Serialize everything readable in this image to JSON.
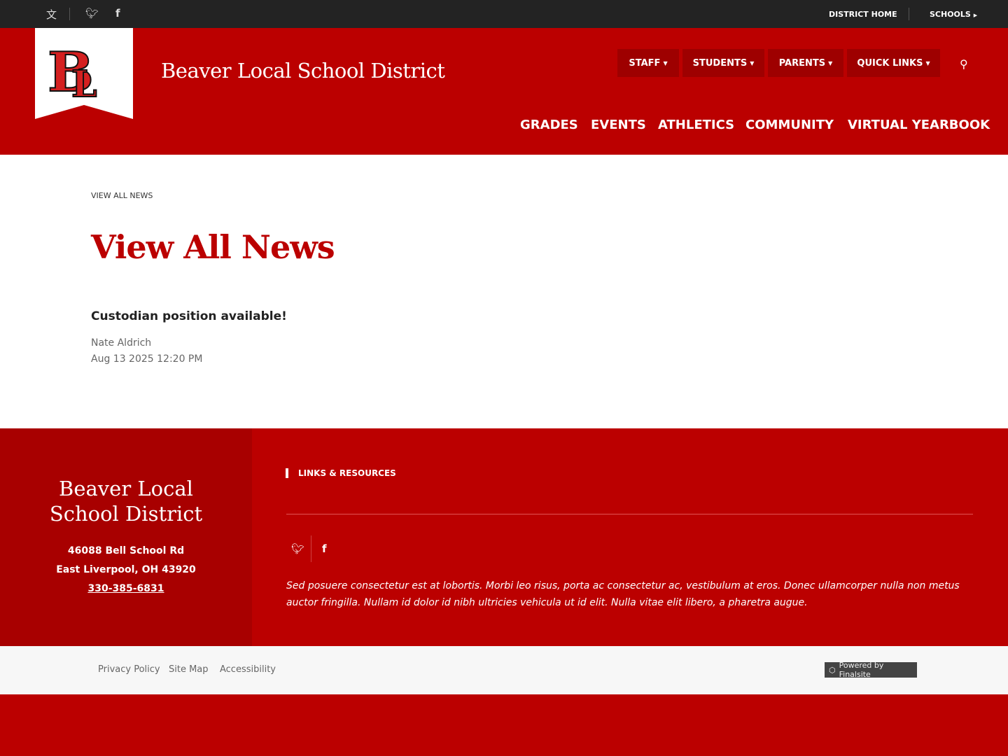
{
  "topbar": {
    "translate_icon": "translate-icon",
    "social": [
      "twitter-icon",
      "facebook-icon"
    ],
    "district_home": "DISTRICT HOME",
    "schools": "SCHOOLS"
  },
  "header": {
    "logo_text": "BL",
    "site_title": "Beaver Local School District",
    "dropdowns": [
      "STAFF",
      "STUDENTS",
      "PARENTS",
      "QUICK LINKS"
    ],
    "main_nav": [
      "GRADES",
      "EVENTS",
      "ATHLETICS",
      "COMMUNITY",
      "VIRTUAL YEARBOOK"
    ]
  },
  "page": {
    "breadcrumb": "VIEW ALL NEWS",
    "title": "View All News",
    "news": [
      {
        "title": "Custodian position available!",
        "author": "Nate Aldrich",
        "date": "Aug 13 2025 12:20 PM"
      }
    ]
  },
  "footer": {
    "name": "Beaver Local School District",
    "address1": "46088 Bell School Rd",
    "address2": "East Liverpool, OH  43920",
    "phone": "330-385-6831",
    "links_heading": "LINKS & RESOURCES",
    "blurb": "Sed posuere consectetur est at lobortis. Morbi leo risus, porta ac consectetur ac, vestibulum at eros. Donec ullamcorper nulla non metus auctor fringilla. Nullam id dolor id nibh ultricies vehicula ut id elit. Nulla vitae elit libero, a pharetra augue."
  },
  "bottom": {
    "links": [
      "Privacy Policy",
      "Site Map",
      "Accessibility"
    ],
    "powered": "Powered by Finalsite"
  },
  "colors": {
    "brand_red": "#bb0000",
    "dark": "#232323"
  }
}
